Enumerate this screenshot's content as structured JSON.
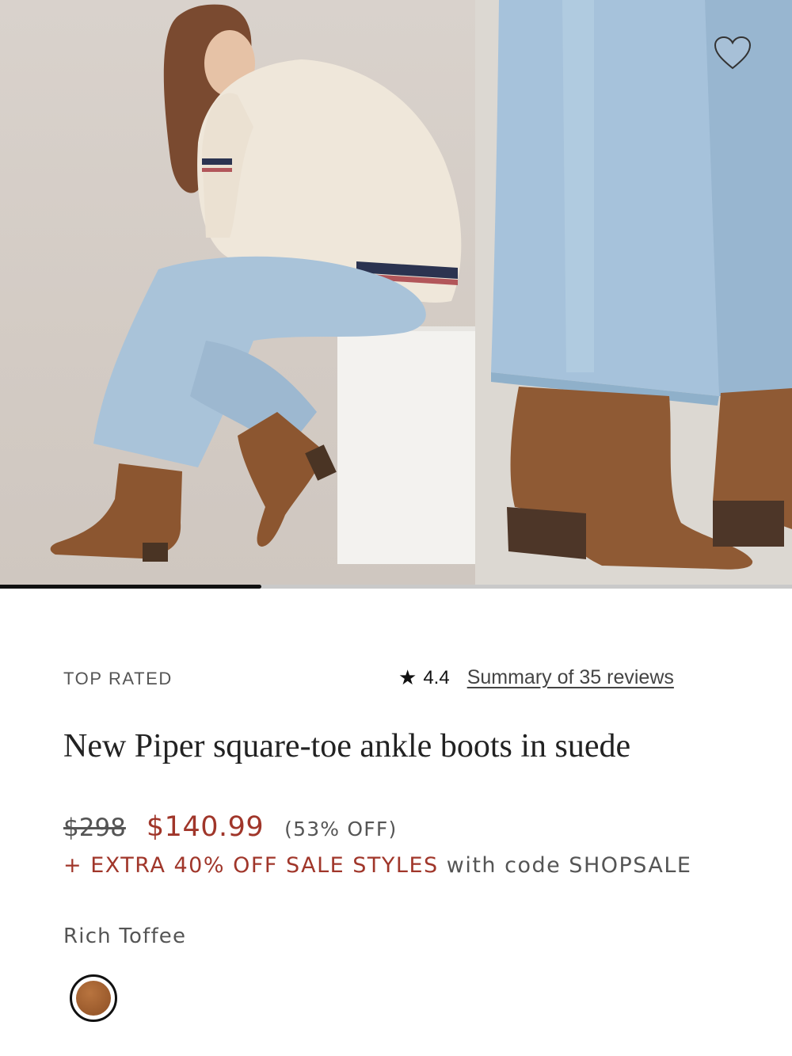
{
  "gallery": {
    "images": [
      {
        "alt": "Model seated wearing cable-knit sweater, jeans and suede ankle boots"
      },
      {
        "alt": "Close-up of suede ankle boot under wide-leg jeans"
      }
    ],
    "progress": 0.33
  },
  "wishlist": {
    "icon": "heart-outline-icon"
  },
  "product": {
    "badge": "TOP RATED",
    "rating": {
      "star": "★",
      "value": "4.4",
      "reviews_link": "Summary of 35 reviews"
    },
    "title": "New Piper square-toe ankle boots in suede",
    "price": {
      "original": "$298",
      "sale": "$140.99",
      "discount": "(53% OFF)"
    },
    "promo": {
      "highlight": "+ EXTRA 40% OFF SALE STYLES",
      "rest": " with code SHOPSALE"
    },
    "color": {
      "name": "Rich Toffee",
      "swatch_hex": "#9a5a2c"
    }
  },
  "colors": {
    "accent_sale": "#a0362a",
    "text_muted": "#555555",
    "text_dark": "#222222"
  }
}
